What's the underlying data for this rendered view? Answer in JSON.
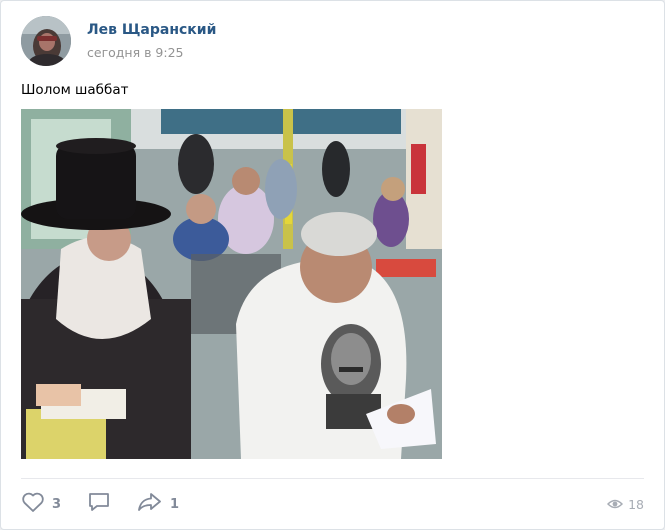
{
  "post": {
    "author_name": "Лев Щаранский",
    "timestamp": "сегодня в 9:25",
    "text": "Шолом шаббат"
  },
  "actions": {
    "like_count": "3",
    "comment_count": "",
    "share_count": "1",
    "views_count": "18",
    "like_icon": "heart-icon",
    "comment_icon": "comment-icon",
    "share_icon": "share-arrow-icon",
    "views_icon": "eye-icon"
  },
  "colors": {
    "author_link": "#2a5885",
    "muted_text": "#939393",
    "action_icon": "#828a99"
  }
}
